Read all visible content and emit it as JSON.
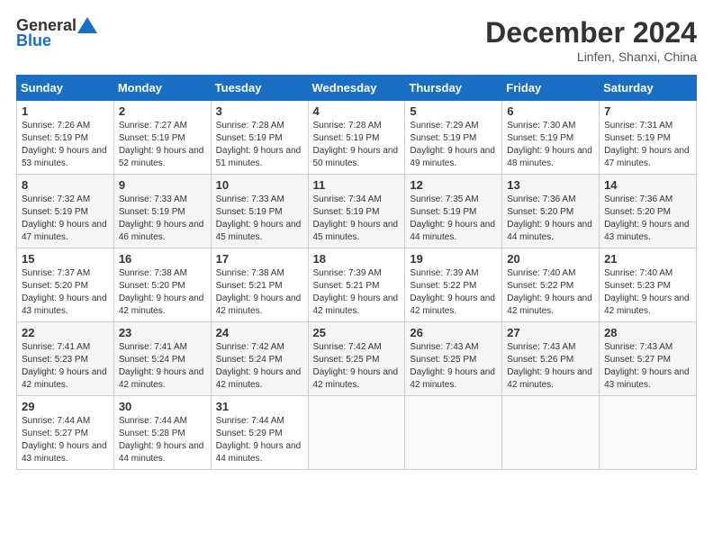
{
  "header": {
    "logo": {
      "general": "General",
      "blue": "Blue"
    },
    "title": "December 2024",
    "location": "Linfen, Shanxi, China"
  },
  "calendar": {
    "days_of_week": [
      "Sunday",
      "Monday",
      "Tuesday",
      "Wednesday",
      "Thursday",
      "Friday",
      "Saturday"
    ],
    "weeks": [
      [
        null,
        {
          "day": "2",
          "sunrise": "Sunrise: 7:27 AM",
          "sunset": "Sunset: 5:19 PM",
          "daylight": "Daylight: 9 hours and 52 minutes."
        },
        {
          "day": "3",
          "sunrise": "Sunrise: 7:28 AM",
          "sunset": "Sunset: 5:19 PM",
          "daylight": "Daylight: 9 hours and 51 minutes."
        },
        {
          "day": "4",
          "sunrise": "Sunrise: 7:28 AM",
          "sunset": "Sunset: 5:19 PM",
          "daylight": "Daylight: 9 hours and 50 minutes."
        },
        {
          "day": "5",
          "sunrise": "Sunrise: 7:29 AM",
          "sunset": "Sunset: 5:19 PM",
          "daylight": "Daylight: 9 hours and 49 minutes."
        },
        {
          "day": "6",
          "sunrise": "Sunrise: 7:30 AM",
          "sunset": "Sunset: 5:19 PM",
          "daylight": "Daylight: 9 hours and 48 minutes."
        },
        {
          "day": "7",
          "sunrise": "Sunrise: 7:31 AM",
          "sunset": "Sunset: 5:19 PM",
          "daylight": "Daylight: 9 hours and 47 minutes."
        }
      ],
      [
        {
          "day": "1",
          "sunrise": "Sunrise: 7:26 AM",
          "sunset": "Sunset: 5:19 PM",
          "daylight": "Daylight: 9 hours and 53 minutes."
        },
        {
          "day": "9",
          "sunrise": "Sunrise: 7:33 AM",
          "sunset": "Sunset: 5:19 PM",
          "daylight": "Daylight: 9 hours and 46 minutes."
        },
        {
          "day": "10",
          "sunrise": "Sunrise: 7:33 AM",
          "sunset": "Sunset: 5:19 PM",
          "daylight": "Daylight: 9 hours and 45 minutes."
        },
        {
          "day": "11",
          "sunrise": "Sunrise: 7:34 AM",
          "sunset": "Sunset: 5:19 PM",
          "daylight": "Daylight: 9 hours and 45 minutes."
        },
        {
          "day": "12",
          "sunrise": "Sunrise: 7:35 AM",
          "sunset": "Sunset: 5:19 PM",
          "daylight": "Daylight: 9 hours and 44 minutes."
        },
        {
          "day": "13",
          "sunrise": "Sunrise: 7:36 AM",
          "sunset": "Sunset: 5:20 PM",
          "daylight": "Daylight: 9 hours and 44 minutes."
        },
        {
          "day": "14",
          "sunrise": "Sunrise: 7:36 AM",
          "sunset": "Sunset: 5:20 PM",
          "daylight": "Daylight: 9 hours and 43 minutes."
        }
      ],
      [
        {
          "day": "8",
          "sunrise": "Sunrise: 7:32 AM",
          "sunset": "Sunset: 5:19 PM",
          "daylight": "Daylight: 9 hours and 47 minutes."
        },
        {
          "day": "16",
          "sunrise": "Sunrise: 7:38 AM",
          "sunset": "Sunset: 5:20 PM",
          "daylight": "Daylight: 9 hours and 42 minutes."
        },
        {
          "day": "17",
          "sunrise": "Sunrise: 7:38 AM",
          "sunset": "Sunset: 5:21 PM",
          "daylight": "Daylight: 9 hours and 42 minutes."
        },
        {
          "day": "18",
          "sunrise": "Sunrise: 7:39 AM",
          "sunset": "Sunset: 5:21 PM",
          "daylight": "Daylight: 9 hours and 42 minutes."
        },
        {
          "day": "19",
          "sunrise": "Sunrise: 7:39 AM",
          "sunset": "Sunset: 5:22 PM",
          "daylight": "Daylight: 9 hours and 42 minutes."
        },
        {
          "day": "20",
          "sunrise": "Sunrise: 7:40 AM",
          "sunset": "Sunset: 5:22 PM",
          "daylight": "Daylight: 9 hours and 42 minutes."
        },
        {
          "day": "21",
          "sunrise": "Sunrise: 7:40 AM",
          "sunset": "Sunset: 5:23 PM",
          "daylight": "Daylight: 9 hours and 42 minutes."
        }
      ],
      [
        {
          "day": "15",
          "sunrise": "Sunrise: 7:37 AM",
          "sunset": "Sunset: 5:20 PM",
          "daylight": "Daylight: 9 hours and 43 minutes."
        },
        {
          "day": "23",
          "sunrise": "Sunrise: 7:41 AM",
          "sunset": "Sunset: 5:24 PM",
          "daylight": "Daylight: 9 hours and 42 minutes."
        },
        {
          "day": "24",
          "sunrise": "Sunrise: 7:42 AM",
          "sunset": "Sunset: 5:24 PM",
          "daylight": "Daylight: 9 hours and 42 minutes."
        },
        {
          "day": "25",
          "sunrise": "Sunrise: 7:42 AM",
          "sunset": "Sunset: 5:25 PM",
          "daylight": "Daylight: 9 hours and 42 minutes."
        },
        {
          "day": "26",
          "sunrise": "Sunrise: 7:43 AM",
          "sunset": "Sunset: 5:25 PM",
          "daylight": "Daylight: 9 hours and 42 minutes."
        },
        {
          "day": "27",
          "sunrise": "Sunrise: 7:43 AM",
          "sunset": "Sunset: 5:26 PM",
          "daylight": "Daylight: 9 hours and 42 minutes."
        },
        {
          "day": "28",
          "sunrise": "Sunrise: 7:43 AM",
          "sunset": "Sunset: 5:27 PM",
          "daylight": "Daylight: 9 hours and 43 minutes."
        }
      ],
      [
        {
          "day": "22",
          "sunrise": "Sunrise: 7:41 AM",
          "sunset": "Sunset: 5:23 PM",
          "daylight": "Daylight: 9 hours and 42 minutes."
        },
        {
          "day": "30",
          "sunrise": "Sunrise: 7:44 AM",
          "sunset": "Sunset: 5:28 PM",
          "daylight": "Daylight: 9 hours and 44 minutes."
        },
        {
          "day": "31",
          "sunrise": "Sunrise: 7:44 AM",
          "sunset": "Sunset: 5:29 PM",
          "daylight": "Daylight: 9 hours and 44 minutes."
        },
        null,
        null,
        null,
        null
      ],
      [
        {
          "day": "29",
          "sunrise": "Sunrise: 7:44 AM",
          "sunset": "Sunset: 5:27 PM",
          "daylight": "Daylight: 9 hours and 43 minutes."
        }
      ]
    ],
    "rows": [
      [
        {
          "day": "1",
          "sunrise": "Sunrise: 7:26 AM",
          "sunset": "Sunset: 5:19 PM",
          "daylight": "Daylight: 9 hours and 53 minutes."
        },
        {
          "day": "2",
          "sunrise": "Sunrise: 7:27 AM",
          "sunset": "Sunset: 5:19 PM",
          "daylight": "Daylight: 9 hours and 52 minutes."
        },
        {
          "day": "3",
          "sunrise": "Sunrise: 7:28 AM",
          "sunset": "Sunset: 5:19 PM",
          "daylight": "Daylight: 9 hours and 51 minutes."
        },
        {
          "day": "4",
          "sunrise": "Sunrise: 7:28 AM",
          "sunset": "Sunset: 5:19 PM",
          "daylight": "Daylight: 9 hours and 50 minutes."
        },
        {
          "day": "5",
          "sunrise": "Sunrise: 7:29 AM",
          "sunset": "Sunset: 5:19 PM",
          "daylight": "Daylight: 9 hours and 49 minutes."
        },
        {
          "day": "6",
          "sunrise": "Sunrise: 7:30 AM",
          "sunset": "Sunset: 5:19 PM",
          "daylight": "Daylight: 9 hours and 48 minutes."
        },
        {
          "day": "7",
          "sunrise": "Sunrise: 7:31 AM",
          "sunset": "Sunset: 5:19 PM",
          "daylight": "Daylight: 9 hours and 47 minutes."
        }
      ],
      [
        {
          "day": "8",
          "sunrise": "Sunrise: 7:32 AM",
          "sunset": "Sunset: 5:19 PM",
          "daylight": "Daylight: 9 hours and 47 minutes."
        },
        {
          "day": "9",
          "sunrise": "Sunrise: 7:33 AM",
          "sunset": "Sunset: 5:19 PM",
          "daylight": "Daylight: 9 hours and 46 minutes."
        },
        {
          "day": "10",
          "sunrise": "Sunrise: 7:33 AM",
          "sunset": "Sunset: 5:19 PM",
          "daylight": "Daylight: 9 hours and 45 minutes."
        },
        {
          "day": "11",
          "sunrise": "Sunrise: 7:34 AM",
          "sunset": "Sunset: 5:19 PM",
          "daylight": "Daylight: 9 hours and 45 minutes."
        },
        {
          "day": "12",
          "sunrise": "Sunrise: 7:35 AM",
          "sunset": "Sunset: 5:19 PM",
          "daylight": "Daylight: 9 hours and 44 minutes."
        },
        {
          "day": "13",
          "sunrise": "Sunrise: 7:36 AM",
          "sunset": "Sunset: 5:20 PM",
          "daylight": "Daylight: 9 hours and 44 minutes."
        },
        {
          "day": "14",
          "sunrise": "Sunrise: 7:36 AM",
          "sunset": "Sunset: 5:20 PM",
          "daylight": "Daylight: 9 hours and 43 minutes."
        }
      ],
      [
        {
          "day": "15",
          "sunrise": "Sunrise: 7:37 AM",
          "sunset": "Sunset: 5:20 PM",
          "daylight": "Daylight: 9 hours and 43 minutes."
        },
        {
          "day": "16",
          "sunrise": "Sunrise: 7:38 AM",
          "sunset": "Sunset: 5:20 PM",
          "daylight": "Daylight: 9 hours and 42 minutes."
        },
        {
          "day": "17",
          "sunrise": "Sunrise: 7:38 AM",
          "sunset": "Sunset: 5:21 PM",
          "daylight": "Daylight: 9 hours and 42 minutes."
        },
        {
          "day": "18",
          "sunrise": "Sunrise: 7:39 AM",
          "sunset": "Sunset: 5:21 PM",
          "daylight": "Daylight: 9 hours and 42 minutes."
        },
        {
          "day": "19",
          "sunrise": "Sunrise: 7:39 AM",
          "sunset": "Sunset: 5:22 PM",
          "daylight": "Daylight: 9 hours and 42 minutes."
        },
        {
          "day": "20",
          "sunrise": "Sunrise: 7:40 AM",
          "sunset": "Sunset: 5:22 PM",
          "daylight": "Daylight: 9 hours and 42 minutes."
        },
        {
          "day": "21",
          "sunrise": "Sunrise: 7:40 AM",
          "sunset": "Sunset: 5:23 PM",
          "daylight": "Daylight: 9 hours and 42 minutes."
        }
      ],
      [
        {
          "day": "22",
          "sunrise": "Sunrise: 7:41 AM",
          "sunset": "Sunset: 5:23 PM",
          "daylight": "Daylight: 9 hours and 42 minutes."
        },
        {
          "day": "23",
          "sunrise": "Sunrise: 7:41 AM",
          "sunset": "Sunset: 5:24 PM",
          "daylight": "Daylight: 9 hours and 42 minutes."
        },
        {
          "day": "24",
          "sunrise": "Sunrise: 7:42 AM",
          "sunset": "Sunset: 5:24 PM",
          "daylight": "Daylight: 9 hours and 42 minutes."
        },
        {
          "day": "25",
          "sunrise": "Sunrise: 7:42 AM",
          "sunset": "Sunset: 5:25 PM",
          "daylight": "Daylight: 9 hours and 42 minutes."
        },
        {
          "day": "26",
          "sunrise": "Sunrise: 7:43 AM",
          "sunset": "Sunset: 5:25 PM",
          "daylight": "Daylight: 9 hours and 42 minutes."
        },
        {
          "day": "27",
          "sunrise": "Sunrise: 7:43 AM",
          "sunset": "Sunset: 5:26 PM",
          "daylight": "Daylight: 9 hours and 42 minutes."
        },
        {
          "day": "28",
          "sunrise": "Sunrise: 7:43 AM",
          "sunset": "Sunset: 5:27 PM",
          "daylight": "Daylight: 9 hours and 43 minutes."
        }
      ],
      [
        {
          "day": "29",
          "sunrise": "Sunrise: 7:44 AM",
          "sunset": "Sunset: 5:27 PM",
          "daylight": "Daylight: 9 hours and 43 minutes."
        },
        {
          "day": "30",
          "sunrise": "Sunrise: 7:44 AM",
          "sunset": "Sunset: 5:28 PM",
          "daylight": "Daylight: 9 hours and 44 minutes."
        },
        {
          "day": "31",
          "sunrise": "Sunrise: 7:44 AM",
          "sunset": "Sunset: 5:29 PM",
          "daylight": "Daylight: 9 hours and 44 minutes."
        },
        null,
        null,
        null,
        null
      ]
    ]
  }
}
